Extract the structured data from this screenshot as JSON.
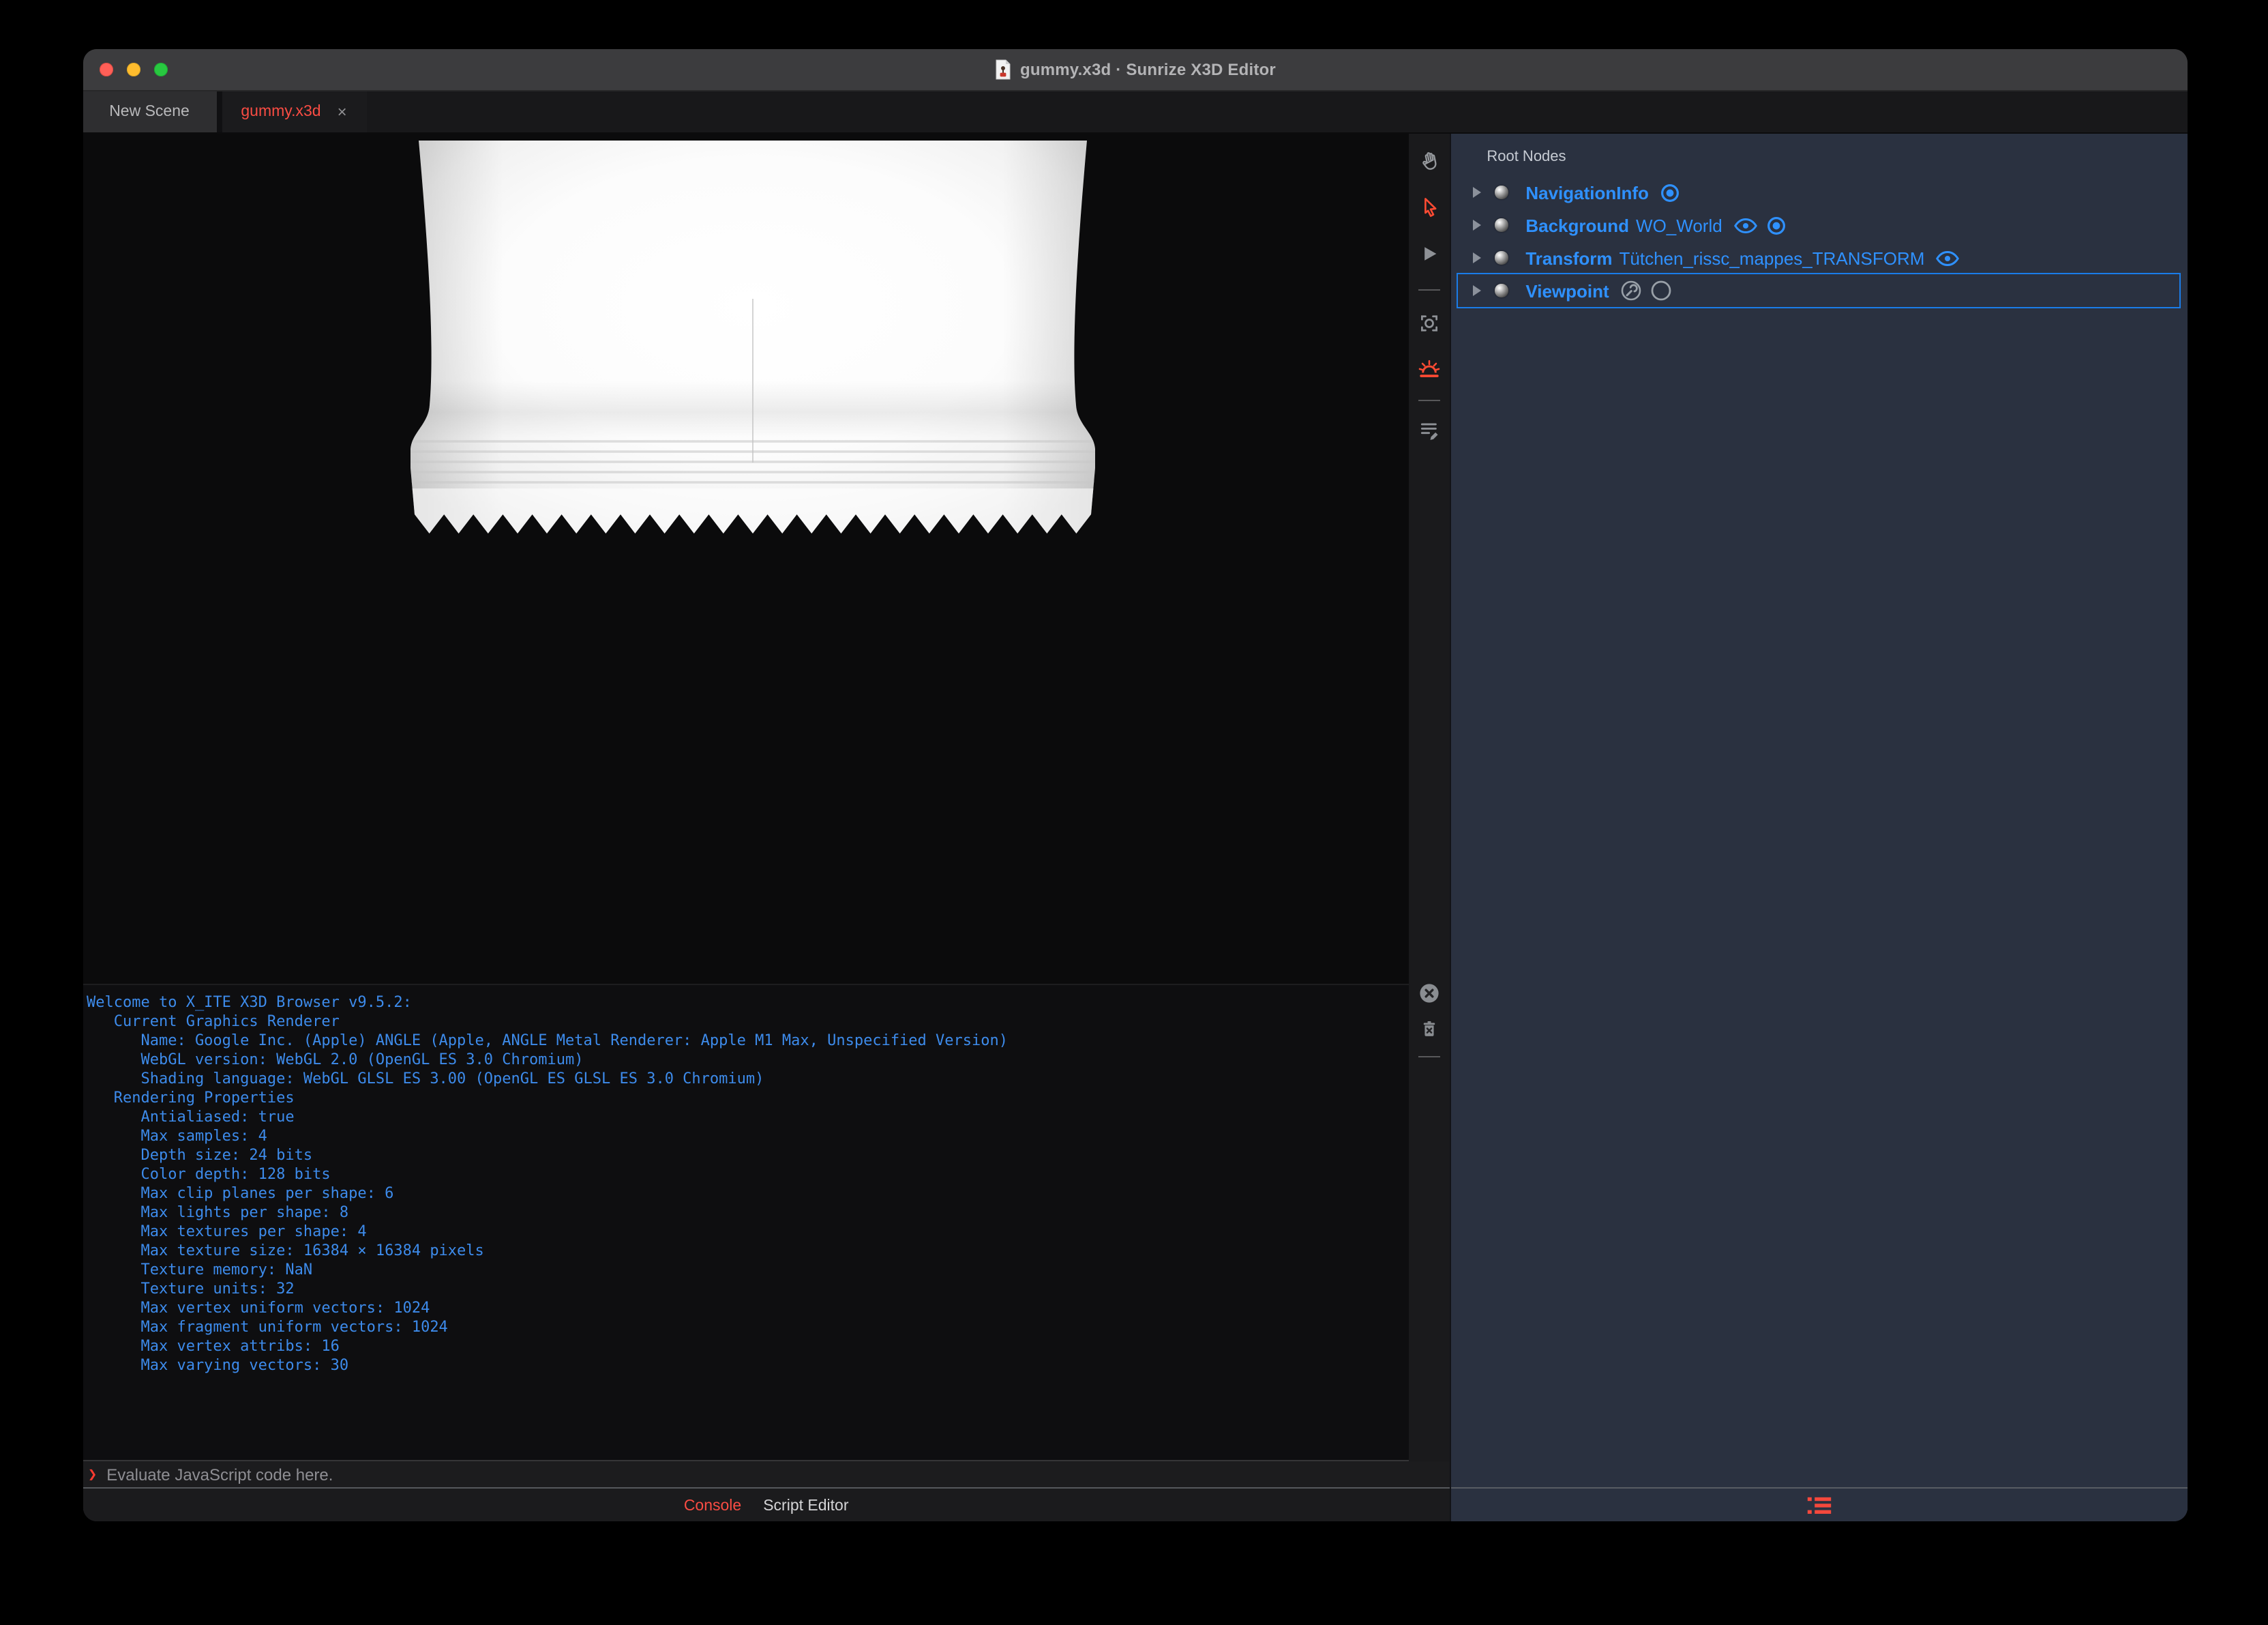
{
  "window": {
    "title": "gummy.x3d · Sunrize X3D Editor"
  },
  "tabs": {
    "new_scene": "New Scene",
    "file": "gummy.x3d",
    "close": "×"
  },
  "viewport_toolbar": {
    "tools": [
      {
        "icon": "pan-hand-icon",
        "active": false
      },
      {
        "icon": "select-arrow-icon",
        "active": true
      },
      {
        "icon": "play-icon",
        "active": false
      },
      {
        "icon": "view-all-camera-icon",
        "active": false
      },
      {
        "icon": "light-sun-icon",
        "active": true
      },
      {
        "icon": "script-edit-icon",
        "active": false
      }
    ]
  },
  "console": {
    "lines": [
      "Welcome to X_ITE X3D Browser v9.5.2:",
      "   Current Graphics Renderer",
      "      Name: Google Inc. (Apple) ANGLE (Apple, ANGLE Metal Renderer: Apple M1 Max, Unspecified Version)",
      "      WebGL version: WebGL 2.0 (OpenGL ES 3.0 Chromium)",
      "      Shading language: WebGL GLSL ES 3.00 (OpenGL ES GLSL ES 3.0 Chromium)",
      "   Rendering Properties",
      "      Antialiased: true",
      "      Max samples: 4",
      "      Depth size: 24 bits",
      "      Color depth: 128 bits",
      "      Max clip planes per shape: 6",
      "      Max lights per shape: 8",
      "      Max textures per shape: 4",
      "      Max texture size: 16384 × 16384 pixels",
      "      Texture memory: NaN",
      "      Texture units: 32",
      "      Max vertex uniform vectors: 1024",
      "      Max fragment uniform vectors: 1024",
      "      Max vertex attribs: 16",
      "      Max varying vectors: 30"
    ],
    "prompt": "❯",
    "placeholder": "Evaluate JavaScript code here.",
    "tabs": {
      "console": "Console",
      "script_editor": "Script Editor"
    },
    "active_tab": "Console"
  },
  "outline": {
    "header": "Root Nodes",
    "nodes": [
      {
        "type": "NavigationInfo",
        "name": "",
        "selected": false,
        "icons": [
          "bound-icon"
        ]
      },
      {
        "type": "Background",
        "name": "WO_World",
        "selected": false,
        "icons": [
          "eye-icon",
          "bound-icon"
        ]
      },
      {
        "type": "Transform",
        "name": "Tütchen_rissc_mappes_TRANSFORM",
        "selected": false,
        "icons": [
          "eye-icon"
        ]
      },
      {
        "type": "Viewpoint",
        "name": "",
        "selected": true,
        "icons": [
          "tool-wrench-icon",
          "empty-circle-icon"
        ]
      }
    ]
  },
  "colors": {
    "accent_red": "#ff4b33",
    "node_blue": "#2f91ff",
    "console_blue": "#3d8beb",
    "panel_bg": "#2a3140",
    "selection_border": "#1a7ce8",
    "traffic_red": "#ff5f57",
    "traffic_yellow": "#febc2e",
    "traffic_green": "#28c840"
  }
}
